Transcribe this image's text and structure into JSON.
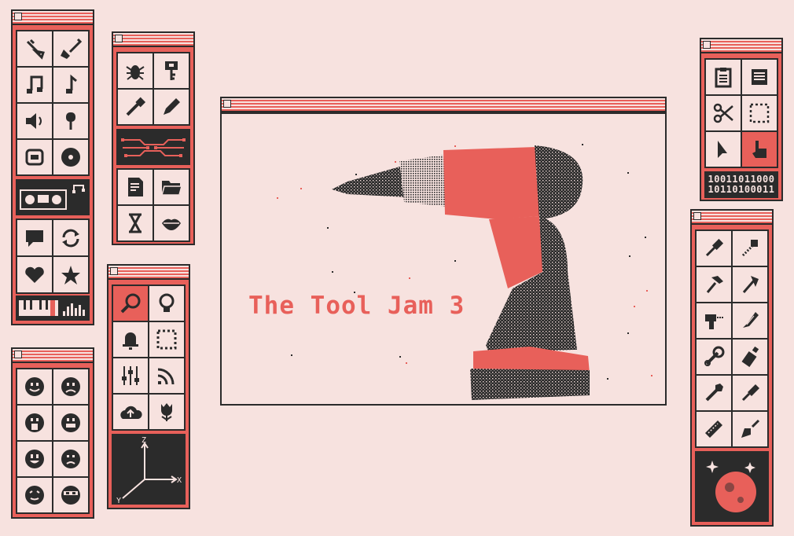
{
  "colors": {
    "background": "#f7e2df",
    "accent": "#e8605a",
    "ink": "#2b2b2b"
  },
  "main_window": {
    "title_text": "The Tool Jam 3",
    "image": "drill-illustration"
  },
  "music_palette": {
    "icons": [
      "trumpet-icon",
      "electric-guitar-icon",
      "music-notes-icon",
      "music-note-icon",
      "speaker-icon",
      "microphone-icon",
      "robot-icon",
      "vinyl-record-icon"
    ],
    "banner": "boombox-icon",
    "icons2": [
      "chat-bubble-icon",
      "refresh-icon",
      "heart-icon",
      "star-icon"
    ],
    "footer": "piano-keyboard-icon"
  },
  "emoji_palette": {
    "icons": [
      "happy-face-icon",
      "sad-face-icon",
      "scared-face-icon",
      "grin-face-icon",
      "smile-face-icon",
      "frown-face-icon",
      "content-face-icon",
      "ninja-face-icon"
    ]
  },
  "dev_palette": {
    "icons": [
      "bug-icon",
      "key-icon",
      "dropper-icon",
      "pencil-icon"
    ],
    "banner": "circuit-icon",
    "icons2": [
      "document-icon",
      "folder-icon",
      "hourglass-icon",
      "lips-icon"
    ]
  },
  "system_palette": {
    "icons": [
      "search-icon",
      "lightbulb-icon",
      "bell-icon",
      "selection-icon",
      "sliders-icon",
      "rss-icon",
      "cloud-upload-icon",
      "tulip-icon"
    ],
    "footer": "xyz-axes-icon",
    "axis_labels": {
      "x": "X",
      "y": "Y",
      "z": "Z"
    }
  },
  "edit_palette": {
    "icons": [
      "clipboard-icon",
      "list-icon",
      "scissors-icon",
      "marquee-icon",
      "arrow-cursor-icon",
      "hand-cursor-icon"
    ],
    "binary_line1": "10011011000",
    "binary_line2": "10110100011"
  },
  "tools_palette": {
    "icons": [
      "screwdriver-icon",
      "drill-bit-icon",
      "hammer-icon",
      "axe-icon",
      "drill-icon",
      "knife-icon",
      "wrench-icon",
      "glue-icon",
      "spanner-icon",
      "brush-icon",
      "saw-icon",
      "trowel-icon"
    ],
    "footer": "planet-icon"
  }
}
